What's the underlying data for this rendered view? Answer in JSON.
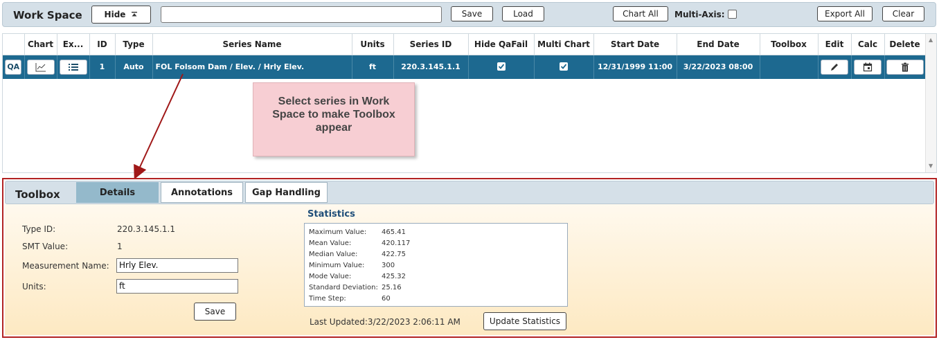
{
  "workspace": {
    "title": "Work Space",
    "hide_label": "Hide",
    "hide_icon": "collapse-up-icon",
    "input_value": "",
    "save_label": "Save",
    "load_label": "Load",
    "chart_all_label": "Chart All",
    "multi_axis_label": "Multi-Axis:",
    "multi_axis_checked": false,
    "export_all_label": "Export All",
    "clear_label": "Clear"
  },
  "grid": {
    "columns": [
      "",
      "Chart",
      "Ex...",
      "ID",
      "Type",
      "Series Name",
      "Units",
      "Series ID",
      "Hide QaFail",
      "Multi Chart",
      "Start Date",
      "End Date",
      "Toolbox",
      "Edit",
      "Calc",
      "Delete"
    ],
    "rows": [
      {
        "qa": "QA",
        "id": "1",
        "type": "Auto",
        "series_name": "FOL Folsom Dam / Elev. / Hrly Elev.",
        "units": "ft",
        "series_id": "220.3.145.1.1",
        "hide_qafail": true,
        "multi_chart": true,
        "start_date": "12/31/1999 11:00",
        "end_date": "3/22/2023 08:00",
        "toolbox": ""
      }
    ]
  },
  "callout": {
    "text": "Select series in Work Space to make Toolbox appear"
  },
  "toolbox": {
    "title": "Toolbox",
    "tabs": [
      "Details",
      "Annotations",
      "Gap Handling"
    ],
    "active_tab": "Details",
    "details": {
      "type_id_label": "Type ID:",
      "type_id_value": "220.3.145.1.1",
      "smt_label": "SMT Value:",
      "smt_value": "1",
      "measurement_label": "Measurement Name:",
      "measurement_value": "Hrly Elev.",
      "units_label": "Units:",
      "units_value": "ft",
      "save_label": "Save"
    },
    "statistics": {
      "title": "Statistics",
      "rows": [
        {
          "label": "Maximum Value:",
          "value": "465.41"
        },
        {
          "label": "Mean Value:",
          "value": "420.117"
        },
        {
          "label": "Median Value:",
          "value": "422.75"
        },
        {
          "label": "Minimum Value:",
          "value": "300"
        },
        {
          "label": "Mode Value:",
          "value": "425.32"
        },
        {
          "label": "Standard Deviation:",
          "value": "25.16"
        },
        {
          "label": "Time Step:",
          "value": "60"
        }
      ],
      "last_updated": "Last Updated:3/22/2023 2:06:11 AM",
      "update_label": "Update Statistics"
    }
  },
  "colors": {
    "selected_row": "#1d6990",
    "header_bar": "#d5e0e8",
    "callout_bg": "#f7ced3",
    "toolbox_border": "#b22222",
    "active_tab": "#94b9cb"
  }
}
